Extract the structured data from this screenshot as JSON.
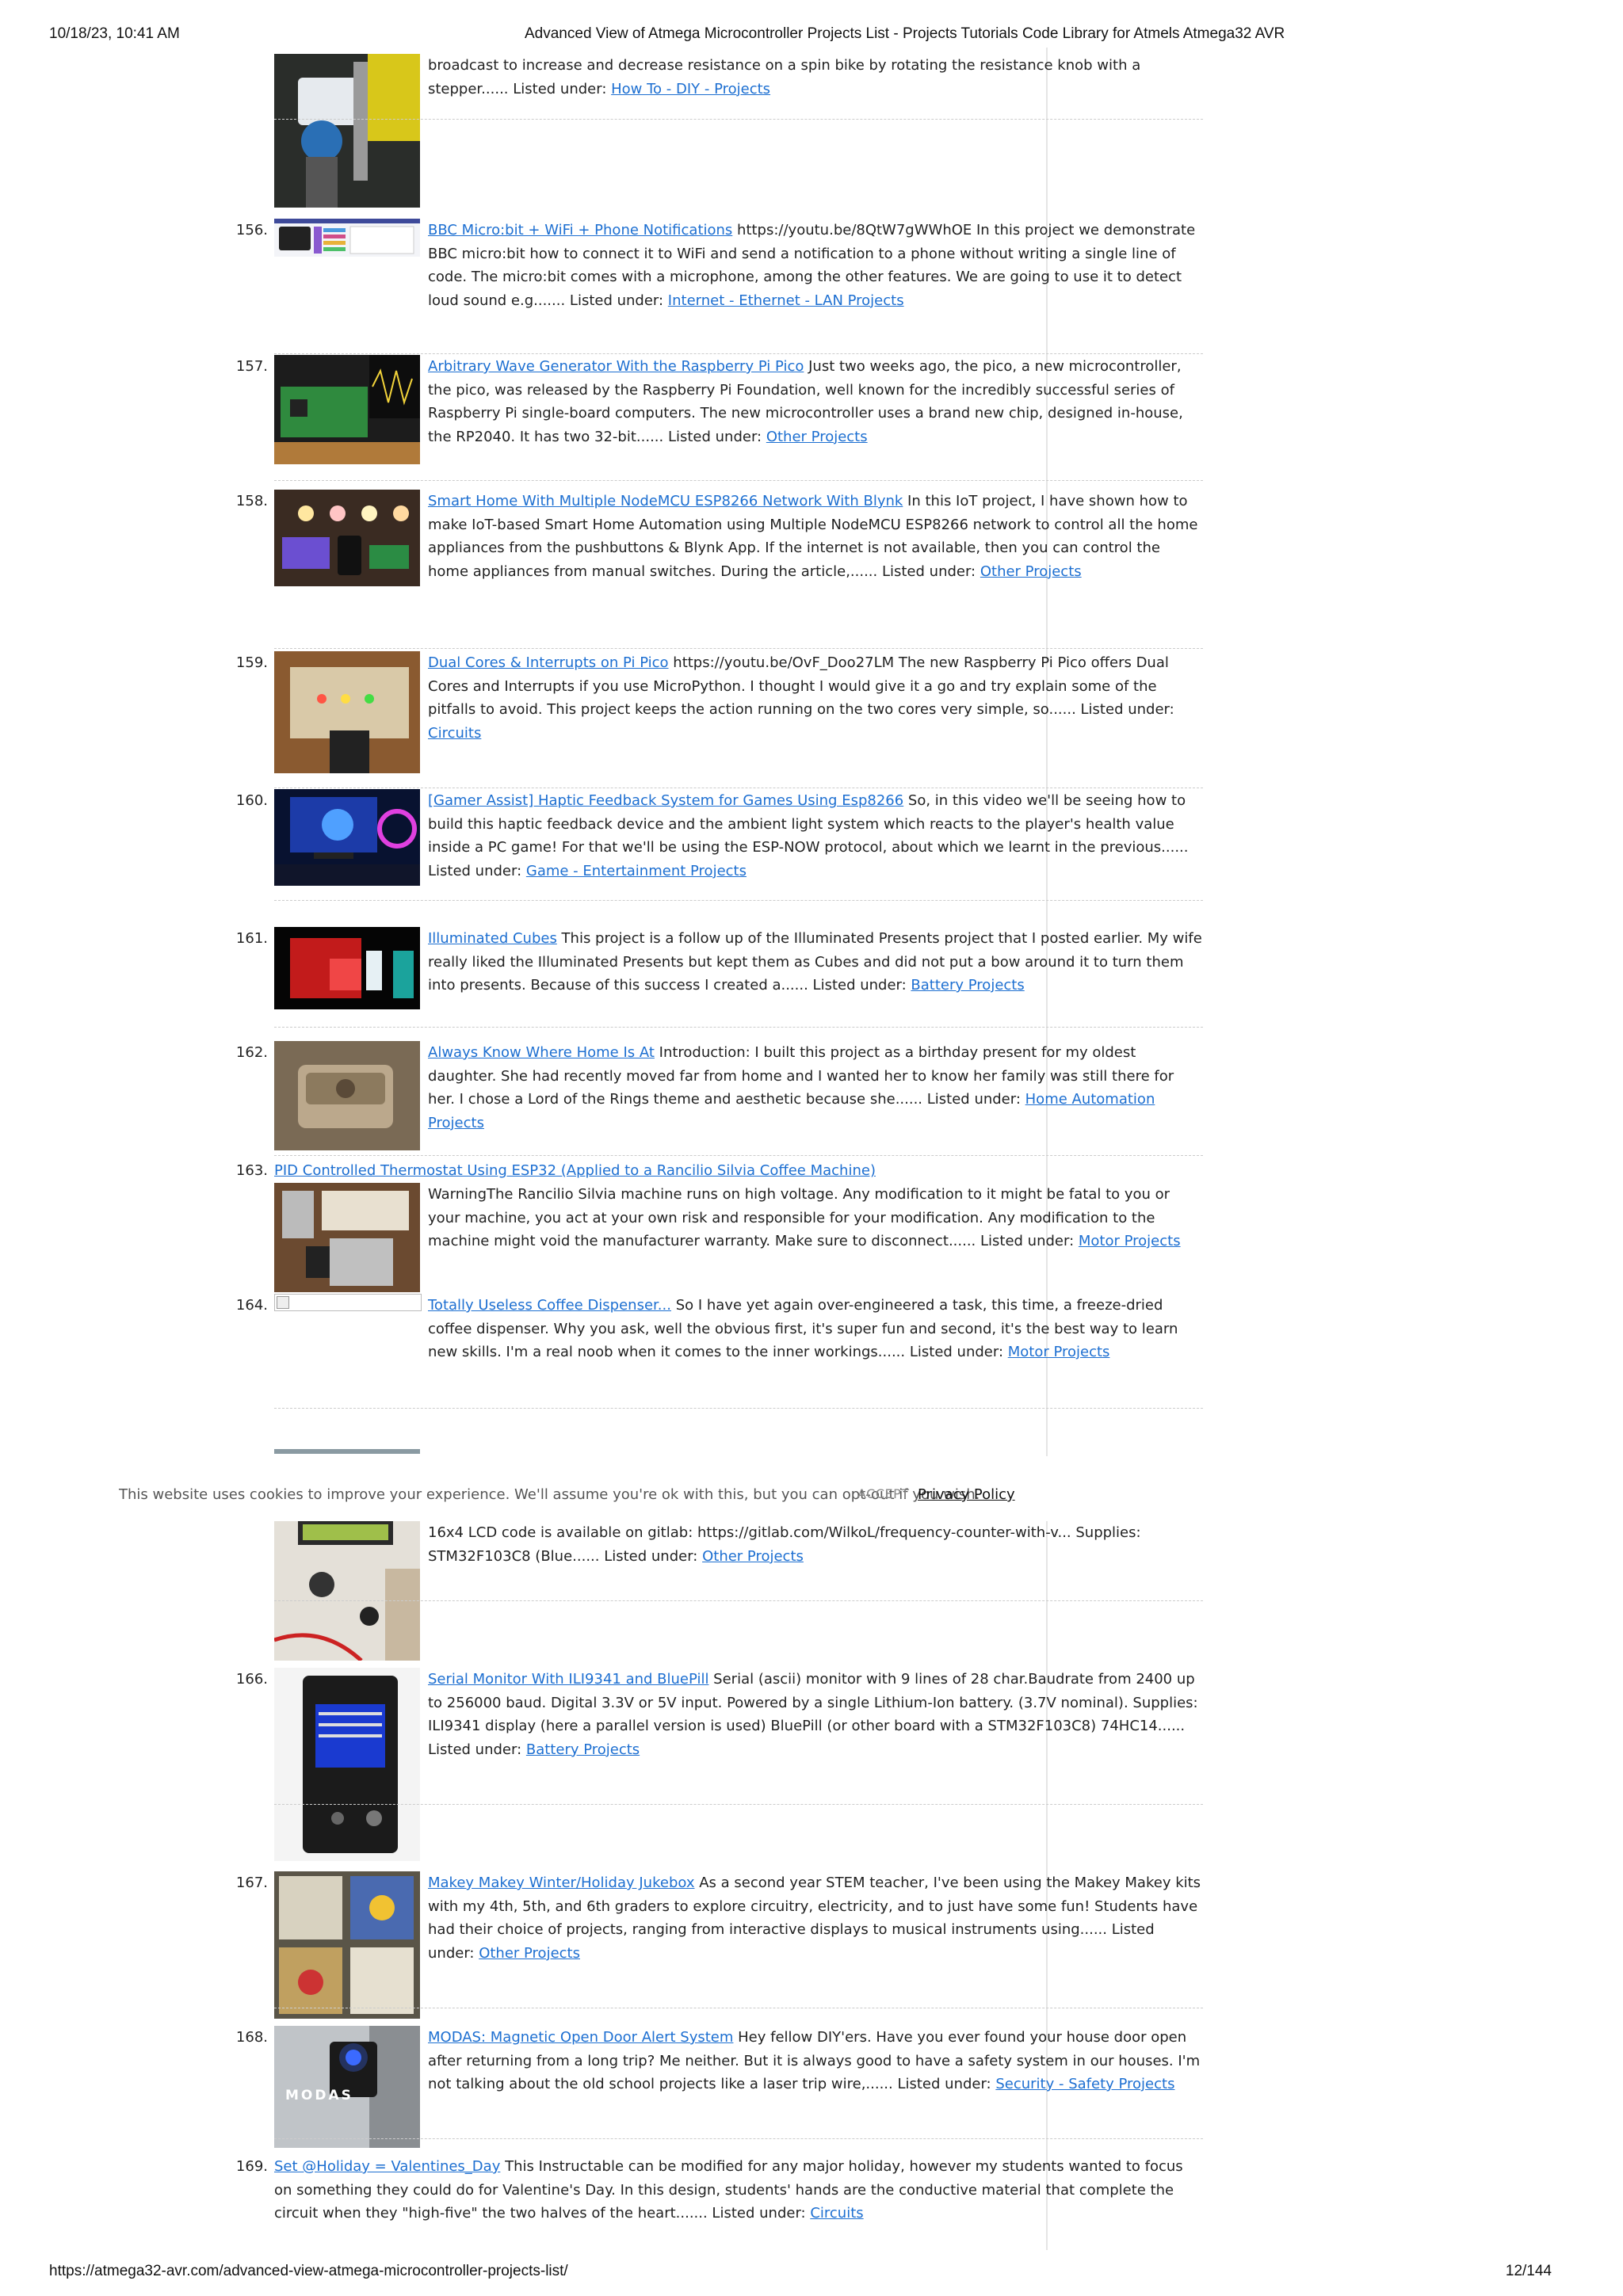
{
  "header": {
    "datetime": "10/18/23, 10:41 AM",
    "title": "Advanced View of Atmega Microcontroller Projects List - Projects Tutorials Code Library for Atmels Atmega32 AVR"
  },
  "footer": {
    "url": "https://atmega32-avr.com/advanced-view-atmega-microcontroller-projects-list/",
    "page": "12/144"
  },
  "cookie": {
    "message": "This website uses cookies to improve your experience. We'll assume you're ok with this, but you can opt-out if you wish.",
    "accept": "ACCEPT",
    "privacy": "Privacy Policy"
  },
  "items": {
    "i155": {
      "text": "broadcast to increase and decrease resistance on a spin bike by rotating the resistance knob with a stepper...... Listed under: ",
      "category": "How To - DIY - Projects"
    },
    "i156": {
      "number": "156.",
      "link": "BBC Micro:bit + WiFi + Phone Notifications",
      "text": " https://youtu.be/8QtW7gWWhOE In this project we demonstrate BBC micro:bit how to connect it to WiFi and send a notification to a phone without writing a single line of code. The micro:bit comes with a microphone, among the other features. We are going to use it to detect loud sound e.g....... Listed under: ",
      "category": "Internet - Ethernet - LAN Projects"
    },
    "i157": {
      "number": "157.",
      "link": "Arbitrary Wave Generator With the Raspberry Pi Pico",
      "text": " Just two weeks ago, the pico, a new microcontroller, the pico, was released by the Raspberry Pi Foundation, well known for the incredibly successful series of Raspberry Pi single-board computers. The new microcontroller uses a brand new chip, designed in-house, the RP2040. It has two 32-bit...... Listed under: ",
      "category": "Other Projects"
    },
    "i158": {
      "number": "158.",
      "link": "Smart Home With Multiple NodeMCU ESP8266 Network With Blynk",
      "text": " In this IoT project, I have shown how to make IoT-based Smart Home Automation using Multiple NodeMCU ESP8266 network to control all the home appliances from the pushbuttons & Blynk App. If the internet is not available, then you can control the home appliances from manual switches. During the article,...... Listed under: ",
      "category": "Other Projects"
    },
    "i159": {
      "number": "159.",
      "link": "Dual Cores & Interrupts on Pi Pico",
      "text": " https://youtu.be/OvF_Doo27LM The new Raspberry Pi Pico offers Dual Cores and Interrupts if you use MicroPython. I thought I would give it a go and try explain some of the pitfalls to avoid. This project keeps the action running on the two cores very simple, so...... Listed under: ",
      "category": "Circuits"
    },
    "i160": {
      "number": "160.",
      "link": "[Gamer Assist] Haptic Feedback System for Games Using Esp8266",
      "text": " So, in this video we'll be seeing how to build this haptic feedback device and the ambient light system which reacts to the player's health value inside a PC game! For that we'll be using the ESP-NOW protocol, about which we learnt in the previous...... Listed under: ",
      "category": "Game - Entertainment Projects"
    },
    "i161": {
      "number": "161.",
      "link": "Illuminated Cubes",
      "text": " This project is a follow up of the Illuminated Presents project that I posted earlier. My wife really liked the Illuminated Presents but kept them as Cubes and did not put a bow around it to turn them into presents. Because of this success I created a...... Listed under: ",
      "category": "Battery Projects"
    },
    "i162": {
      "number": "162.",
      "link": "Always Know Where Home Is At",
      "text": " Introduction: I built this project as a birthday present for my oldest daughter. She had recently moved far from home and I wanted her to know her family was still there for her. I chose a Lord of the Rings theme and aesthetic because she...... Listed under: ",
      "category": "Home Automation Projects"
    },
    "i163": {
      "number": "163.",
      "link": "PID Controlled Thermostat Using ESP32 (Applied to a Rancilio Silvia Coffee Machine)",
      "text": " WarningThe Rancilio Silvia machine runs on high voltage. Any modification to it might be fatal to you or your machine, you act at your own risk and responsible for your modification. Any modification to the machine might void the manufacturer warranty. Make sure to disconnect...... Listed under: ",
      "category": "Motor Projects"
    },
    "i164": {
      "number": "164.",
      "link": "Totally Useless Coffee Dispenser...",
      "text": " So I have yet again over-engineered a task, this time, a freeze-dried coffee dispenser. Why you ask, well the obvious first, it's super fun and second, it's the best way to learn new skills. I'm a real noob when it comes to the inner workings...... Listed under: ",
      "category": "Motor Projects"
    },
    "i165": {
      "text": "16x4 LCD code is available on gitlab: https://gitlab.com/WilkoL/frequency-counter-with-v... Supplies: STM32F103C8 (Blue...... Listed under: ",
      "category": "Other Projects"
    },
    "i166": {
      "number": "166.",
      "link": "Serial Monitor With ILI9341 and BluePill",
      "text": " Serial (ascii) monitor with 9 lines of 28 char.Baudrate from 2400 up to 256000 baud. Digital 3.3V or 5V input. Powered by a single Lithium-Ion battery. (3.7V nominal). Supplies: ILI9341 display (here a parallel version is used) BluePill (or other board with a STM32F103C8) 74HC14...... Listed under: ",
      "category": "Battery Projects"
    },
    "i167": {
      "number": "167.",
      "link": "Makey Makey Winter/Holiday Jukebox",
      "text": " As a second year STEM teacher, I've been using the Makey Makey kits with my 4th, 5th, and 6th graders to explore circuitry, electricity, and to just have some fun! Students have had their choice of projects, ranging from interactive displays to musical instruments using...... Listed under: ",
      "category": "Other Projects"
    },
    "i168": {
      "number": "168.",
      "link": "MODAS: Magnetic Open Door Alert System",
      "text": " Hey fellow DIY'ers. Have you ever found your house door open after returning from a long trip? Me neither. But it is always good to have a safety system in our houses. I'm not talking about the old school projects like a laser trip wire,...... Listed under: ",
      "category": "Security - Safety Projects",
      "thumb_caption": "MODAS"
    },
    "i169": {
      "number": "169.",
      "link": "Set @Holiday = Valentines_Day",
      "text": " This Instructable can be modified for any major holiday, however my students wanted to focus on something they could do for Valentine's Day. In this design, students' hands are the conductive material that complete the circuit when they \"high-five\" the two halves of the heart....... Listed under: ",
      "category": "Circuits"
    }
  }
}
